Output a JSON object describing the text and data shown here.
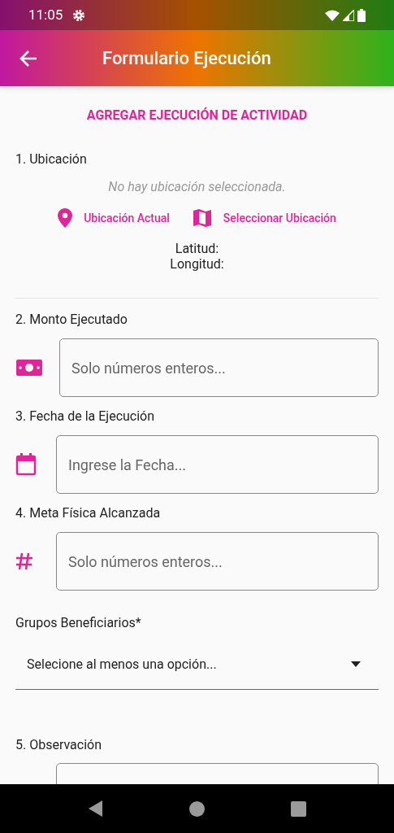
{
  "status_bar": {
    "time": "11:05"
  },
  "app_bar": {
    "title": "Formulario Ejecución"
  },
  "form": {
    "heading": "AGREGAR EJECUCIÓN DE ACTIVIDAD",
    "location": {
      "label": "1. Ubicación",
      "empty_message": "No hay ubicación seleccionada.",
      "actions": [
        {
          "kind": "current",
          "label": "Ubicación Actual"
        },
        {
          "kind": "map",
          "label": "Seleccionar Ubicación"
        }
      ],
      "latitude_label": "Latitud:",
      "longitude_label": "Longitud:"
    },
    "fields": [
      {
        "kind": "money",
        "label": "2. Monto Ejecutado",
        "placeholder": "Solo números enteros..."
      },
      {
        "kind": "date",
        "label": "3. Fecha de la Ejecución",
        "placeholder": "Ingrese la Fecha..."
      },
      {
        "kind": "number",
        "label": "4. Meta Física Alcanzada",
        "placeholder": "Solo números enteros..."
      },
      {
        "kind": "select",
        "label": "Grupos Beneficiarios*",
        "placeholder": "Selecione al menos una opción..."
      },
      {
        "kind": "textarea",
        "label": "5. Observación"
      }
    ]
  }
}
